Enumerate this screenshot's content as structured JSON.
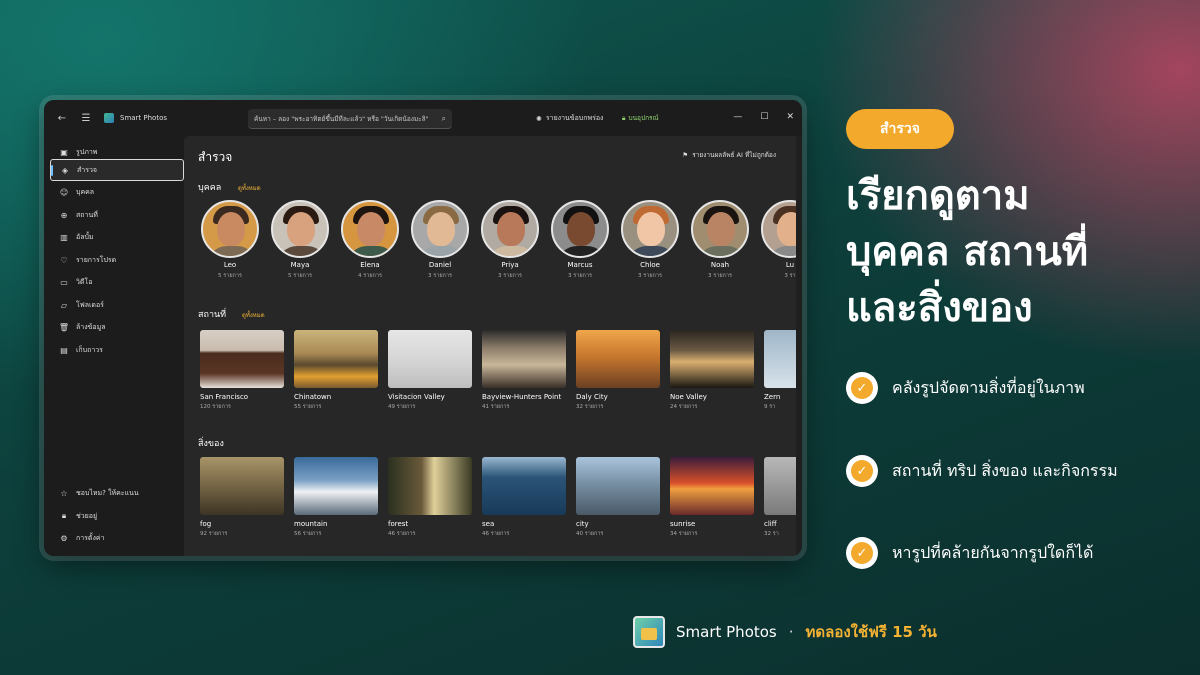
{
  "window": {
    "app_title": "Smart Photos",
    "search_placeholder": "ค้นหา – ลอง \"พระอาทิตย์ขึ้นมีทีละแล้ว\" หรือ \"วันเกิดน้องมะลิ\"",
    "report_label": "รายงานข้อบกพร่อง",
    "lock_label": "บนอุปกรณ์"
  },
  "sidebar": {
    "items": [
      {
        "label": "รูปภาพ",
        "icon": "image-icon"
      },
      {
        "label": "สำรวจ",
        "icon": "explore-icon",
        "active": true
      },
      {
        "label": "บุคคล",
        "icon": "people-icon"
      },
      {
        "label": "สถานที่",
        "icon": "globe-icon"
      },
      {
        "label": "อัลบั้ม",
        "icon": "album-icon"
      },
      {
        "label": "รายการโปรด",
        "icon": "heart-icon"
      },
      {
        "label": "วิดีโอ",
        "icon": "video-icon"
      },
      {
        "label": "โฟลเดอร์",
        "icon": "folder-icon"
      },
      {
        "label": "ล้างข้อมูล",
        "icon": "trash-icon"
      },
      {
        "label": "เก็บถาวร",
        "icon": "archive-icon"
      }
    ],
    "bottom_items": [
      {
        "label": "ชอบไหม? ให้คะแนน",
        "icon": "star-icon"
      },
      {
        "label": "ช่วยอยู่",
        "icon": "lock-icon"
      },
      {
        "label": "การตั้งค่า",
        "icon": "gear-icon"
      }
    ]
  },
  "main": {
    "title": "สำรวจ",
    "flag_link": "รายงานผลลัพธ์ AI ที่ไม่ถูกต้อง",
    "people": {
      "title": "บุคคล",
      "see_all": "ดูทั้งหมด",
      "items": [
        {
          "name": "Leo",
          "count": "5 รายการ"
        },
        {
          "name": "Maya",
          "count": "5 รายการ"
        },
        {
          "name": "Elena",
          "count": "4 รายการ"
        },
        {
          "name": "Daniel",
          "count": "3 รายการ"
        },
        {
          "name": "Priya",
          "count": "3 รายการ"
        },
        {
          "name": "Marcus",
          "count": "3 รายการ"
        },
        {
          "name": "Chloe",
          "count": "3 รายการ"
        },
        {
          "name": "Noah",
          "count": "3 รายการ"
        },
        {
          "name": "Lu",
          "count": "3 รา"
        }
      ]
    },
    "places": {
      "title": "สถานที่",
      "see_all": "ดูทั้งหมด",
      "items": [
        {
          "name": "San Francisco",
          "count": "120 รายการ"
        },
        {
          "name": "Chinatown",
          "count": "55 รายการ"
        },
        {
          "name": "Visitacion Valley",
          "count": "49 รายการ"
        },
        {
          "name": "Bayview-Hunters Point",
          "count": "41 รายการ"
        },
        {
          "name": "Daly City",
          "count": "32 รายการ"
        },
        {
          "name": "Noe Valley",
          "count": "24 รายการ"
        },
        {
          "name": "Zern",
          "count": "9 รา"
        }
      ]
    },
    "things": {
      "title": "สิ่งของ",
      "items": [
        {
          "name": "fog",
          "count": "92 รายการ"
        },
        {
          "name": "mountain",
          "count": "56 รายการ"
        },
        {
          "name": "forest",
          "count": "46 รายการ"
        },
        {
          "name": "sea",
          "count": "46 รายการ"
        },
        {
          "name": "city",
          "count": "40 รายการ"
        },
        {
          "name": "sunrise",
          "count": "34 รายการ"
        },
        {
          "name": "cliff",
          "count": "32 รา"
        }
      ]
    }
  },
  "promo": {
    "pill": "สำรวจ",
    "headline_lines": [
      "เรียกดูตาม",
      "บุคคล สถานที่",
      "และสิ่งของ"
    ],
    "bullets": [
      "คลังรูปจัดตามสิ่งที่อยู่ในภาพ",
      "สถานที่ ทริป สิ่งของ และกิจกรรม",
      "หารูปที่คล้ายกันจากรูปใดก็ได้"
    ],
    "footer_name": "Smart Photos",
    "footer_dot": "·",
    "footer_trial": "ทดลองใช้ฟรี 15 วัน"
  },
  "colors": {
    "accent": "#f3a92b",
    "link_yellow": "#f0b43a",
    "secure_green": "#8fd46f",
    "active_indicator": "#6cc0ff"
  }
}
